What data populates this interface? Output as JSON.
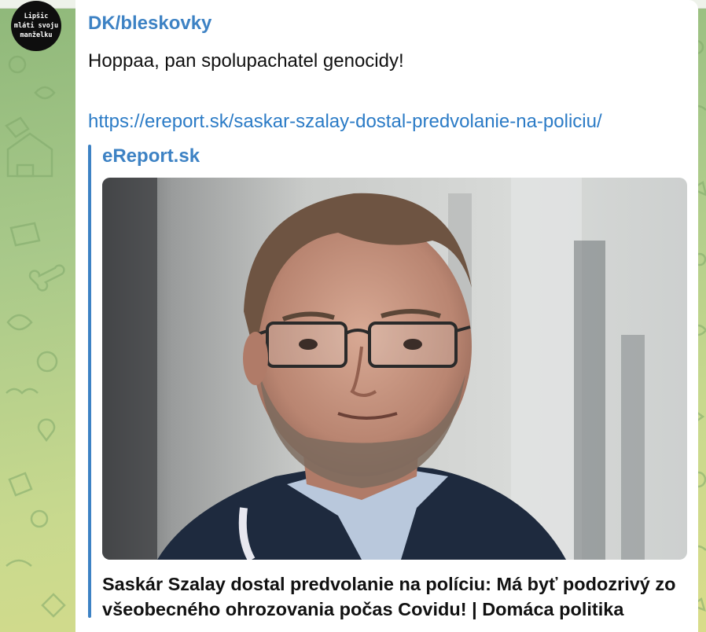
{
  "channel": {
    "avatar_text": "Lipšic\nmláti svoju\nmanželku",
    "name": "DK/bleskovky"
  },
  "message": {
    "text": "Hoppaa, pan spolupachatel genocidy!",
    "link": "https://ereport.sk/saskar-szalay-dostal-predvolanie-na-policiu/"
  },
  "preview": {
    "site_name": "eReport.sk",
    "title": "Saskár Szalay dostal predvolanie na políciu: Má byť podozrivý zo všeobecného ohrozovania počas Covidu! | Domáca politika",
    "image": "photo of a man with glasses and a beard"
  },
  "colors": {
    "accent": "#3d82c4",
    "link": "#2b7bc6",
    "bubble": "#ffffff"
  }
}
